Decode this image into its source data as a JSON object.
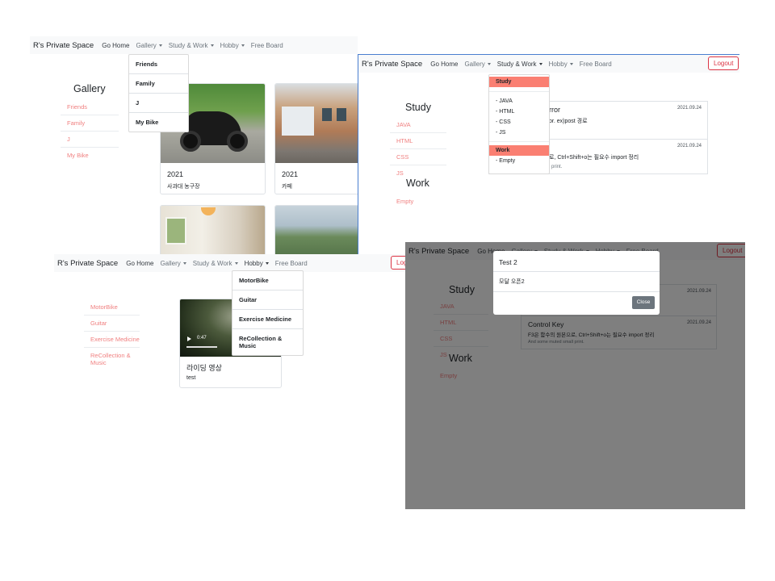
{
  "nav": {
    "brand": "R's Private Space",
    "home": "Go Home",
    "gallery": "Gallery",
    "study_work": "Study & Work",
    "hobby": "Hobby",
    "free_board": "Free Board",
    "logout": "Logout"
  },
  "gallery": {
    "title": "Gallery",
    "sidebar": [
      "Friends",
      "Family",
      "J",
      "My Bike"
    ],
    "dropdown": [
      "Friends",
      "Family",
      "J",
      "My Bike"
    ],
    "cards": [
      {
        "title": "2021",
        "text": "사과대 농구장"
      },
      {
        "title": "2021",
        "text": "카페"
      }
    ]
  },
  "study": {
    "title": "Study",
    "sidebar": [
      "JAVA",
      "HTML",
      "CSS",
      "JS"
    ],
    "work_title": "Work",
    "work_sidebar": [
      "Empty"
    ],
    "dropdown": {
      "study_header": "Study",
      "study_items": [
        "- JAVA",
        "- HTML",
        "- CSS",
        "- JS"
      ],
      "work_header": "Work",
      "work_items": [
        "- Empty"
      ]
    },
    "posts": [
      {
        "title_fragment": "rror",
        "text_fragment": "or. ex)post 경로",
        "date": "2021.09.24"
      },
      {
        "text_fragment": "로, Ctrl+Shift+o는 필요수 import 정리",
        "small_fragment": "l print.",
        "date": "2021.09.24"
      }
    ]
  },
  "hobby": {
    "sidebar": [
      "MotorBike",
      "Guitar",
      "Exercise Medicine",
      "ReCollection & Music"
    ],
    "dropdown": [
      "MotorBike",
      "Guitar",
      "Exercise Medicine",
      "ReCollection & Music"
    ],
    "video": {
      "time": "0:47",
      "title": "라이딩 영상",
      "text": "test"
    }
  },
  "modal_view": {
    "modal_title": "Test 2",
    "modal_body": "모달 오픈2",
    "close": "Close",
    "post1_date": "2021.09.24",
    "post2_title": "Control Key",
    "post2_text": "F3은 함수의 원본으로, Ctrl+Shift+o는 필요수 import 정리",
    "post2_small": "And some muted small print.",
    "post2_date": "2021.09.24"
  },
  "colors": {
    "accent": "#f08080",
    "logout": "#dc3545",
    "dropdown_active": "#fa7f72"
  }
}
